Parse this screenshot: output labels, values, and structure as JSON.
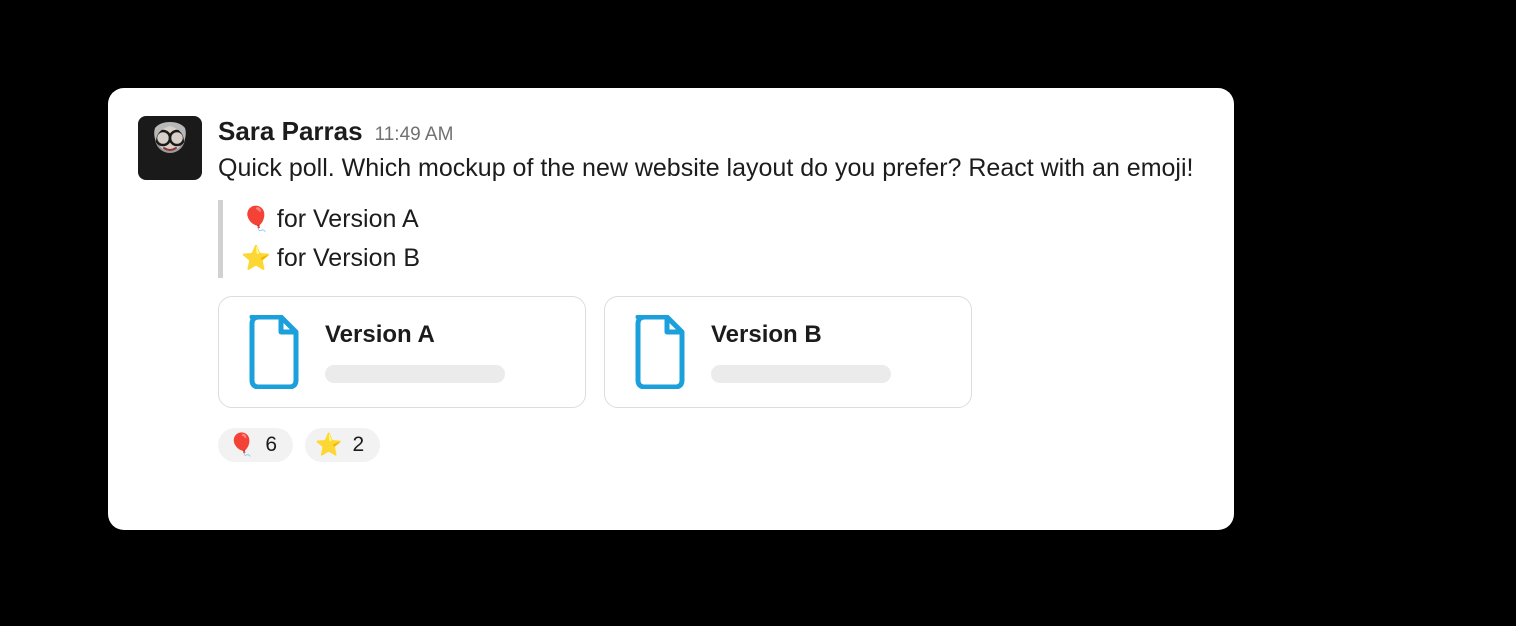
{
  "message": {
    "author": "Sara Parras",
    "timestamp": "11:49 AM",
    "body": "Quick poll. Which mockup of the new website layout do you prefer? React with an emoji!",
    "options": [
      {
        "emoji": "🎈",
        "text": "for Version A"
      },
      {
        "emoji": "⭐",
        "text": "for Version B"
      }
    ],
    "attachments": [
      {
        "title": "Version A"
      },
      {
        "title": "Version B"
      }
    ],
    "reactions": [
      {
        "emoji": "🎈",
        "count": "6"
      },
      {
        "emoji": "⭐",
        "count": "2"
      }
    ]
  }
}
